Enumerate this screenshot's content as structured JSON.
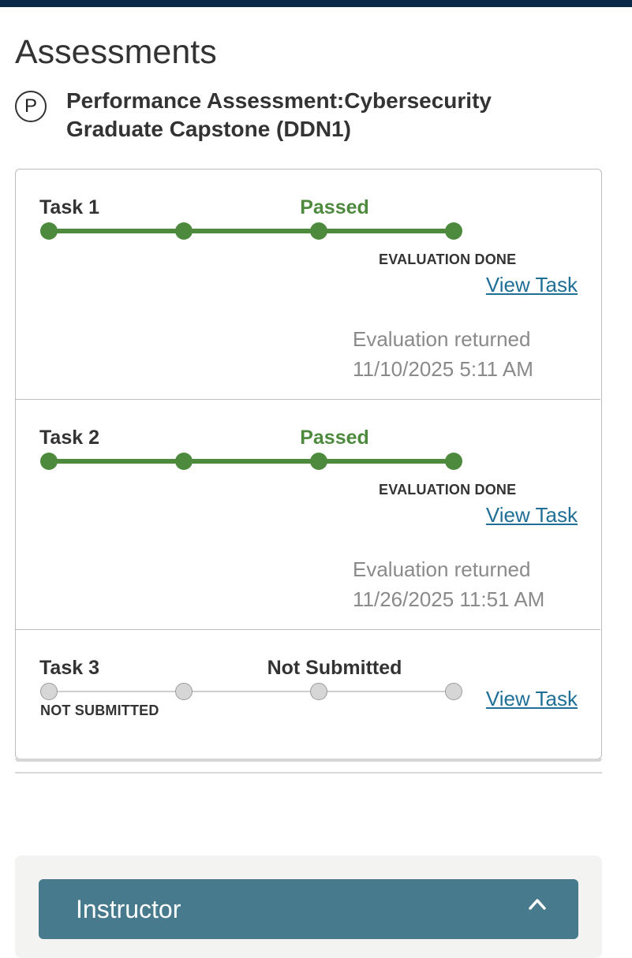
{
  "page": {
    "title": "Assessments"
  },
  "course": {
    "icon_letter": "P",
    "title": "Performance Assessment:Cybersecurity Graduate Capstone (DDN1)"
  },
  "tasks": [
    {
      "label": "Task 1",
      "status": "Passed",
      "substatus": "EVALUATION DONE",
      "link": "View Task",
      "returned_label": "Evaluation returned",
      "returned_date": "11/10/2025 5:11 AM",
      "progress_steps_completed": 4,
      "progress_steps_total": 4
    },
    {
      "label": "Task 2",
      "status": "Passed",
      "substatus": "EVALUATION DONE",
      "link": "View Task",
      "returned_label": "Evaluation returned",
      "returned_date": "11/26/2025 11:51 AM",
      "progress_steps_completed": 4,
      "progress_steps_total": 4
    },
    {
      "label": "Task 3",
      "status": "Not Submitted",
      "substatus": "NOT SUBMITTED",
      "link": "View Task",
      "progress_steps_completed": 0,
      "progress_steps_total": 4
    }
  ],
  "instructor": {
    "label": "Instructor",
    "icon": "chevron-up-icon"
  },
  "colors": {
    "header_bar": "#0b2a4a",
    "passed": "#4e8a3e",
    "link": "#1f6f96",
    "instructor_bg": "#467a8c"
  }
}
